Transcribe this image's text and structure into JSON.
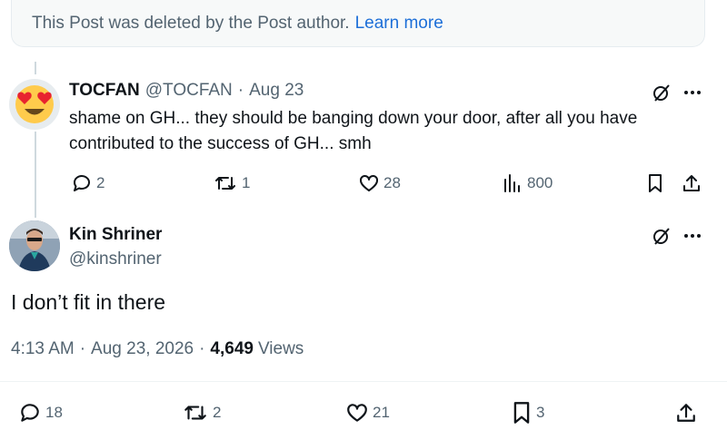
{
  "deleted_notice": {
    "text": "This Post was deleted by the Post author.",
    "link": "Learn more"
  },
  "reply": {
    "name": "TOCFAN",
    "handle": "@TOCFAN",
    "separator": "·",
    "date": "Aug 23",
    "text": "shame on GH... they should be banging down your door, after all you have contributed to the success of GH... smh",
    "avatar": "heart-eyes-emoji",
    "actions": {
      "replies": "2",
      "reposts": "1",
      "likes": "28",
      "views": "800"
    }
  },
  "post": {
    "name": "Kin Shriner",
    "handle": "@kinshriner",
    "text": "I don’t fit in there",
    "time": "4:13 AM",
    "separator": "·",
    "date": "Aug 23, 2026",
    "views_count": "4,649",
    "views_label": "Views",
    "actions": {
      "replies": "18",
      "reposts": "2",
      "likes": "21",
      "bookmarks": "3"
    }
  },
  "icons": [
    "grok-icon",
    "more-icon",
    "reply-icon",
    "repost-icon",
    "like-icon",
    "views-icon",
    "bookmark-icon",
    "share-icon"
  ],
  "colors": {
    "text": "#0f1419",
    "secondary": "#536471",
    "link": "#1d6fd8",
    "line": "#cfd9de"
  }
}
